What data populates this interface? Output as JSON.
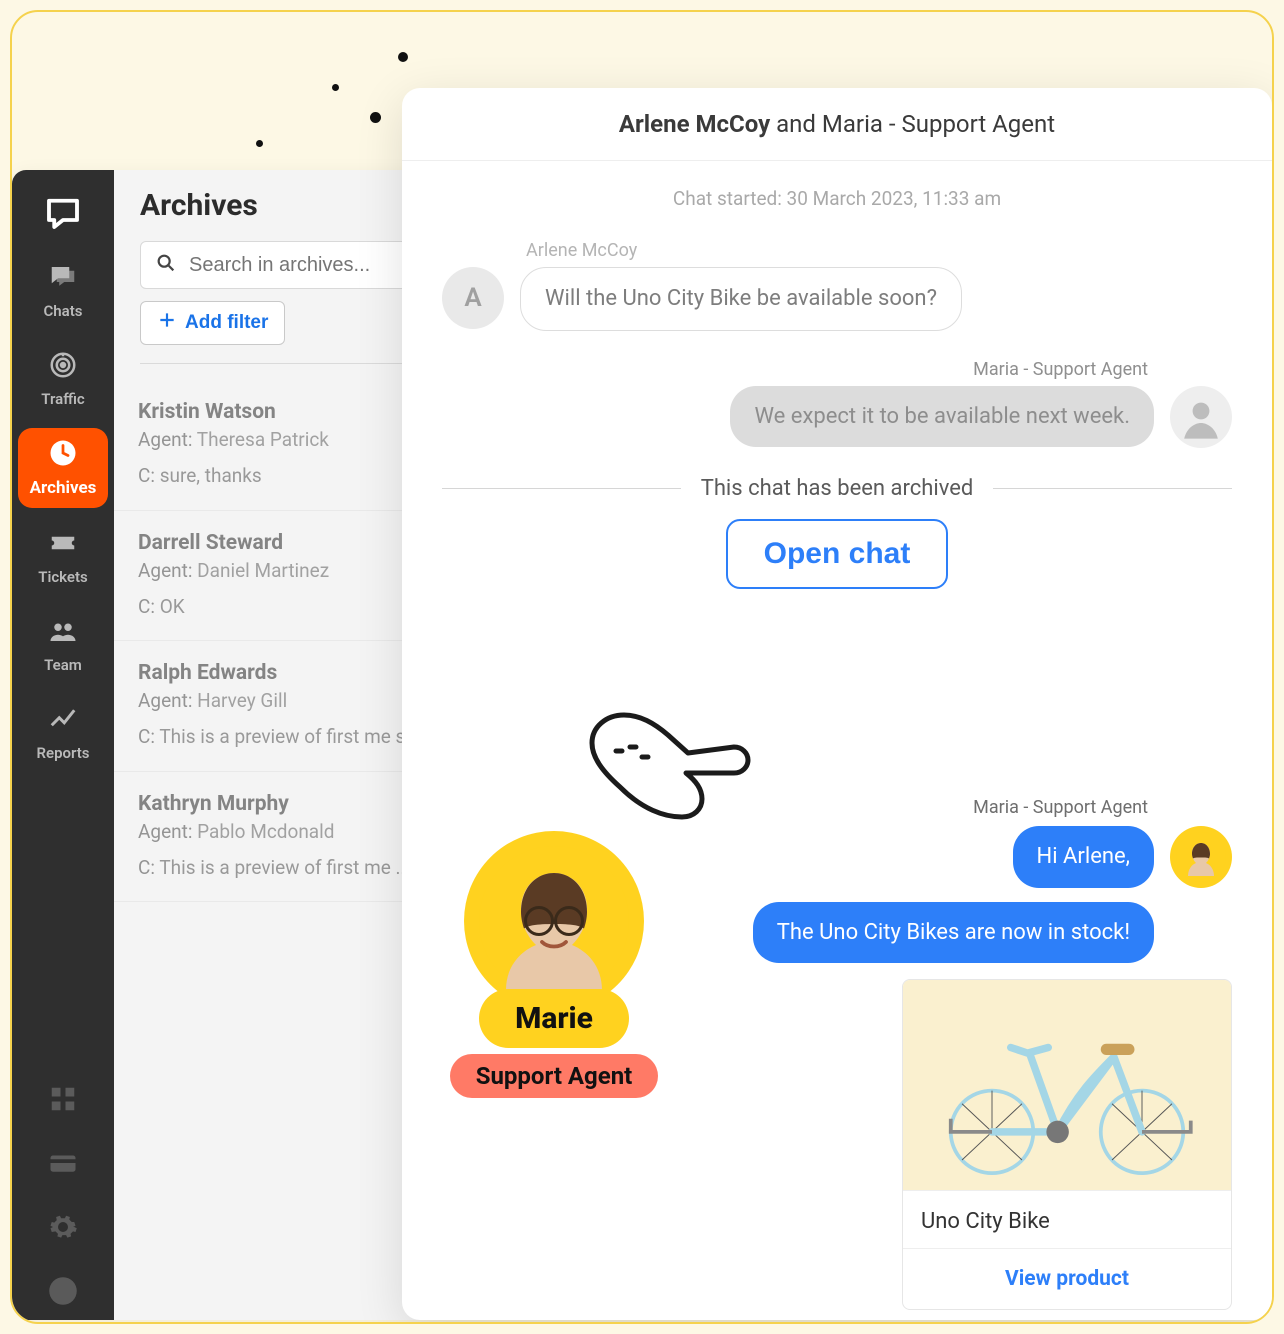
{
  "sidebar": {
    "items": [
      {
        "label": "Chats"
      },
      {
        "label": "Traffic"
      },
      {
        "label": "Archives"
      },
      {
        "label": "Tickets"
      },
      {
        "label": "Team"
      },
      {
        "label": "Reports"
      }
    ]
  },
  "archives": {
    "title": "Archives",
    "search_placeholder": "Search in archives...",
    "add_filter": "Add filter",
    "list": [
      {
        "name": "Kristin Watson",
        "agent_label": "Agent:",
        "agent": "Theresa Patrick",
        "preview_prefix": "C:",
        "preview": "sure, thanks"
      },
      {
        "name": "Darrell Steward",
        "agent_label": "Agent:",
        "agent": "Daniel Martinez",
        "preview_prefix": "C:",
        "preview": "OK"
      },
      {
        "name": "Ralph Edwards",
        "agent_label": "Agent:",
        "agent": "Harvey Gill",
        "preview_prefix": "C:",
        "preview": "This is a preview of first me send i ..."
      },
      {
        "name": "Kathryn Murphy",
        "agent_label": "Agent:",
        "agent": "Pablo Mcdonald",
        "preview_prefix": "C:",
        "preview": "This is a preview of first me ..."
      }
    ]
  },
  "chat": {
    "header_primary": "Arlene McCoy",
    "header_rest": " and Maria - Support Agent",
    "started": "Chat started: 30 March 2023, 11:33 am",
    "visitor_name": "Arlene McCoy",
    "visitor_initial": "A",
    "agent_name": "Maria - Support Agent",
    "messages": {
      "visitor1": "Will the Uno City Bike be available soon?",
      "agent1": "We expect it to be available next week.",
      "agent2": "Hi Arlene,",
      "agent3": "The Uno City Bikes are now in stock!"
    },
    "archived_text": "This chat has been archived",
    "open_chat": "Open chat"
  },
  "agent_card": {
    "name": "Marie",
    "role": "Support Agent"
  },
  "product": {
    "name": "Uno City Bike",
    "cta": "View product"
  },
  "colors": {
    "accent_orange": "#ff5100",
    "accent_blue": "#2d7ff9",
    "brand_yellow": "#ffd21f",
    "pill_coral": "#ff7a66"
  }
}
